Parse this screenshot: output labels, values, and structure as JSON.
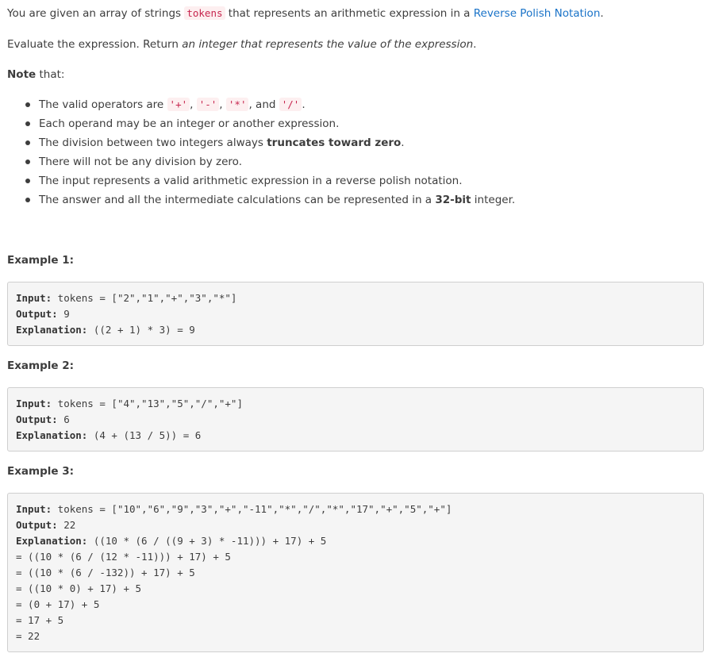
{
  "intro": {
    "part1": "You are given an array of strings ",
    "code": "tokens",
    "part2": " that represents an arithmetic expression in a ",
    "link": "Reverse Polish Notation",
    "part3": "."
  },
  "evaluate": {
    "part1": "Evaluate the expression. Return ",
    "emph": "an integer that represents the value of the expression",
    "part2": "."
  },
  "note": {
    "bold": "Note",
    "rest": " that:"
  },
  "notes": {
    "n1": {
      "a": "The valid operators are ",
      "op1": "'+'",
      "sep1": ", ",
      "op2": "'-'",
      "sep2": ", ",
      "op3": "'*'",
      "sep3": ", and ",
      "op4": "'/'",
      "end": "."
    },
    "n2": "Each operand may be an integer or another expression.",
    "n3": {
      "a": "The division between two integers always ",
      "b": "truncates toward zero",
      "c": "."
    },
    "n4": "There will not be any division by zero.",
    "n5": "The input represents a valid arithmetic expression in a reverse polish notation.",
    "n6": {
      "a": "The answer and all the intermediate calculations can be represented in a ",
      "b": "32-bit",
      "c": " integer."
    }
  },
  "examples": [
    {
      "title": "Example 1:",
      "input_label": "Input:",
      "input": " tokens = [\"2\",\"1\",\"+\",\"3\",\"*\"]",
      "output_label": "Output:",
      "output": " 9",
      "expl_label": "Explanation:",
      "expl": " ((2 + 1) * 3) = 9"
    },
    {
      "title": "Example 2:",
      "input_label": "Input:",
      "input": " tokens = [\"4\",\"13\",\"5\",\"/\",\"+\"]",
      "output_label": "Output:",
      "output": " 6",
      "expl_label": "Explanation:",
      "expl": " (4 + (13 / 5)) = 6"
    },
    {
      "title": "Example 3:",
      "input_label": "Input:",
      "input": " tokens = [\"10\",\"6\",\"9\",\"3\",\"+\",\"-11\",\"*\",\"/\",\"*\",\"17\",\"+\",\"5\",\"+\"]",
      "output_label": "Output:",
      "output": " 22",
      "expl_label": "Explanation:",
      "expl": " ((10 * (6 / ((9 + 3) * -11))) + 17) + 5",
      "steps": [
        "= ((10 * (6 / (12 * -11))) + 17) + 5",
        "= ((10 * (6 / -132)) + 17) + 5",
        "= ((10 * 0) + 17) + 5",
        "= (0 + 17) + 5",
        "= 17 + 5",
        "= 22"
      ]
    }
  ]
}
